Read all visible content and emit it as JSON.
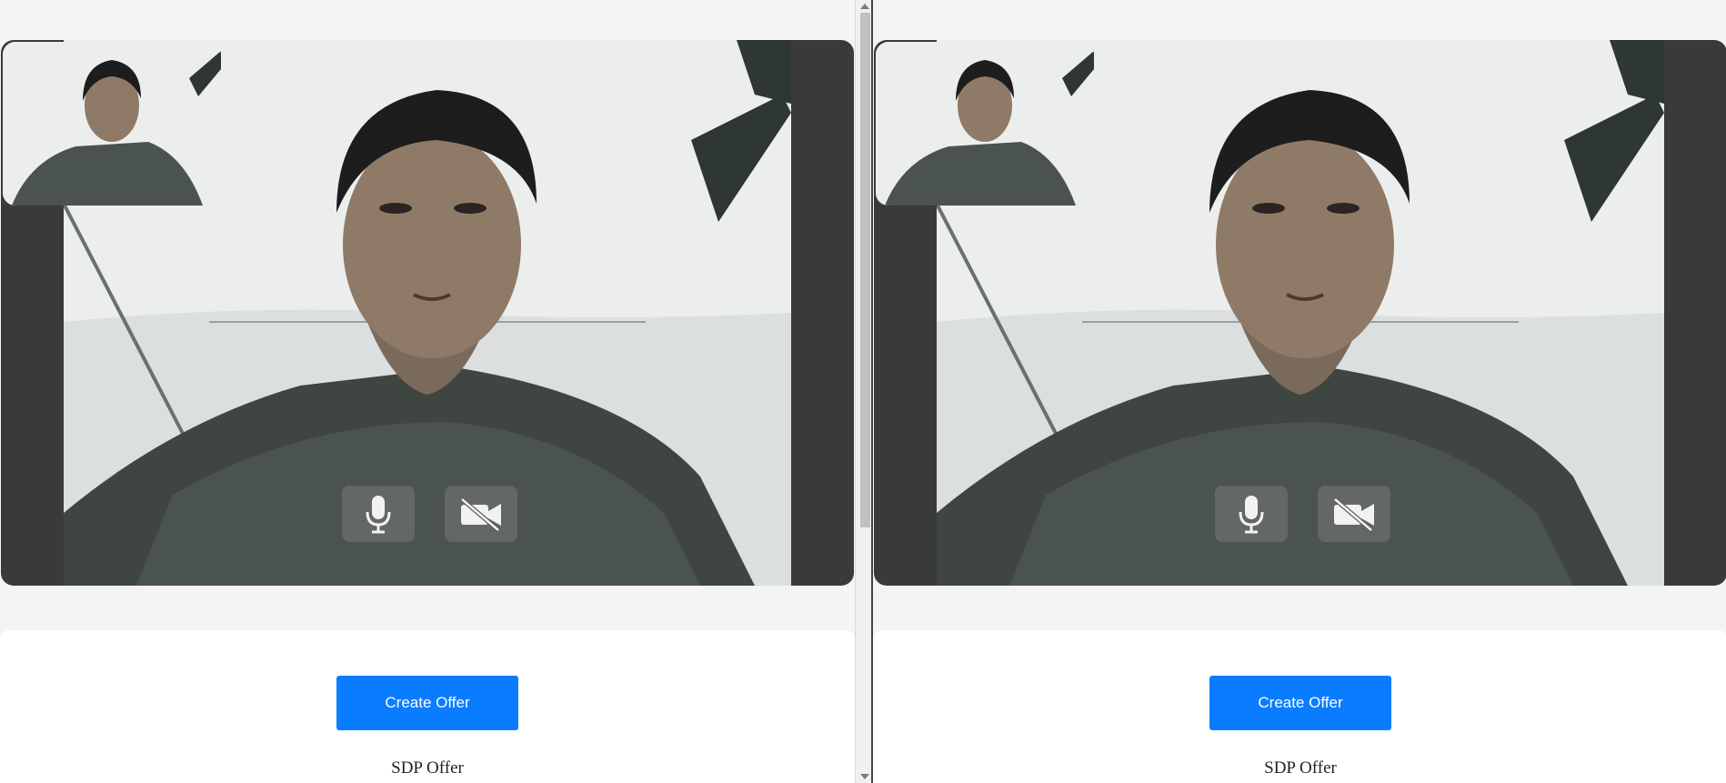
{
  "panes": [
    {
      "controls": {
        "mic_icon": "microphone-icon",
        "camera_icon": "camera-off-icon"
      },
      "offer_button_label": "Create Offer",
      "sdp_label": "SDP Offer"
    },
    {
      "controls": {
        "mic_icon": "microphone-icon",
        "camera_icon": "camera-off-icon"
      },
      "offer_button_label": "Create Offer",
      "sdp_label": "SDP Offer"
    }
  ],
  "colors": {
    "primary_button": "#0a7cff",
    "video_background": "#3a3a3a",
    "page_background": "#f4f4f4"
  }
}
